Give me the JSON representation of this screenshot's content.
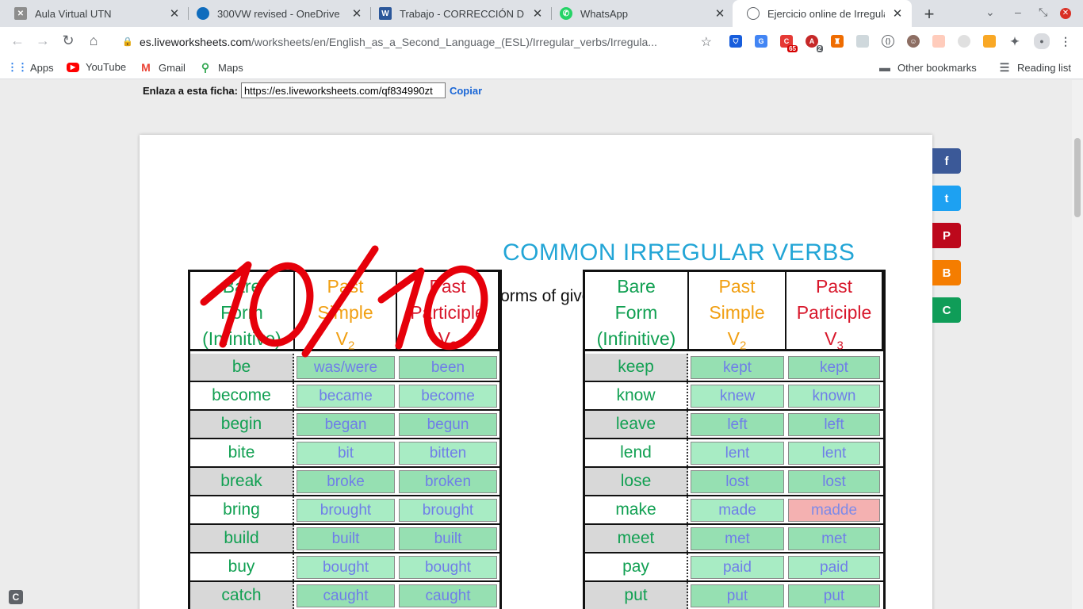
{
  "tabs": [
    {
      "label": "Aula Virtual UTN",
      "icon": "moodle-icon"
    },
    {
      "label": "300VW revised - OneDrive",
      "icon": "onedrive-icon"
    },
    {
      "label": "Trabajo - CORRECCIÓN DE LA",
      "icon": "word-icon"
    },
    {
      "label": "WhatsApp",
      "icon": "whatsapp-icon"
    },
    {
      "label": "Ejercicio online de Irregular",
      "icon": "globe-icon"
    }
  ],
  "address": {
    "domain": "es.liveworksheets.com",
    "path": "/worksheets/en/English_as_a_Second_Language_(ESL)/Irregular_verbs/Irregula..."
  },
  "extensions": {
    "badge_1": "65",
    "badge_2": "2"
  },
  "bookmarks": {
    "apps": "Apps",
    "youtube": "YouTube",
    "gmail": "Gmail",
    "maps": "Maps",
    "other": "Other bookmarks",
    "reading": "Reading list"
  },
  "link_share": {
    "label": "Enlaza a esta ficha:",
    "url": "https://es.liveworksheets.com/qf834990zt",
    "copy": "Copiar"
  },
  "worksheet": {
    "title": "COMMON IRREGULAR VERBS",
    "instruction": "Write the Past Simple and Past Participle forms of given verbs.",
    "score": "10/10",
    "headers": {
      "bare": [
        "Bare",
        "Form",
        "(Infinitive)"
      ],
      "simple": [
        "Past",
        "Simple",
        "V",
        "2"
      ],
      "participle": [
        "Past",
        "Participle",
        "V",
        "3"
      ]
    },
    "left_rows": [
      {
        "bare": "be",
        "v2": "was/were",
        "v3": "been",
        "v3_wrong": false
      },
      {
        "bare": "become",
        "v2": "became",
        "v3": "become",
        "v3_wrong": false
      },
      {
        "bare": "begin",
        "v2": "began",
        "v3": "begun",
        "v3_wrong": false
      },
      {
        "bare": "bite",
        "v2": "bit",
        "v3": "bitten",
        "v3_wrong": false
      },
      {
        "bare": "break",
        "v2": "broke",
        "v3": "broken",
        "v3_wrong": false
      },
      {
        "bare": "bring",
        "v2": "brought",
        "v3": "brought",
        "v3_wrong": false
      },
      {
        "bare": "build",
        "v2": "built",
        "v3": "built",
        "v3_wrong": false
      },
      {
        "bare": "buy",
        "v2": "bought",
        "v3": "bought",
        "v3_wrong": false
      },
      {
        "bare": "catch",
        "v2": "caught",
        "v3": "caught",
        "v3_wrong": false
      }
    ],
    "right_rows": [
      {
        "bare": "keep",
        "v2": "kept",
        "v3": "kept",
        "v3_wrong": false
      },
      {
        "bare": "know",
        "v2": "knew",
        "v3": "known",
        "v3_wrong": false
      },
      {
        "bare": "leave",
        "v2": "left",
        "v3": "left",
        "v3_wrong": false
      },
      {
        "bare": "lend",
        "v2": "lent",
        "v3": "lent",
        "v3_wrong": false
      },
      {
        "bare": "lose",
        "v2": "lost",
        "v3": "lost",
        "v3_wrong": false
      },
      {
        "bare": "make",
        "v2": "made",
        "v3": "madde",
        "v3_wrong": true
      },
      {
        "bare": "meet",
        "v2": "met",
        "v3": "met",
        "v3_wrong": false
      },
      {
        "bare": "pay",
        "v2": "paid",
        "v3": "paid",
        "v3_wrong": false
      },
      {
        "bare": "put",
        "v2": "put",
        "v3": "put",
        "v3_wrong": false
      }
    ]
  },
  "share_buttons": [
    {
      "name": "facebook",
      "glyph": "f",
      "color": "#3b5998"
    },
    {
      "name": "twitter",
      "glyph": "t",
      "color": "#1da1f2"
    },
    {
      "name": "pinterest",
      "glyph": "P",
      "color": "#bd081c"
    },
    {
      "name": "blogger",
      "glyph": "B",
      "color": "#f57d00"
    },
    {
      "name": "classroom",
      "glyph": "C",
      "color": "#0f9d58"
    }
  ],
  "colors": {
    "title": "#22a5d6",
    "bare": "#11a052",
    "simple": "#f19f12",
    "participle": "#d8182c",
    "score": "#e6000a"
  }
}
